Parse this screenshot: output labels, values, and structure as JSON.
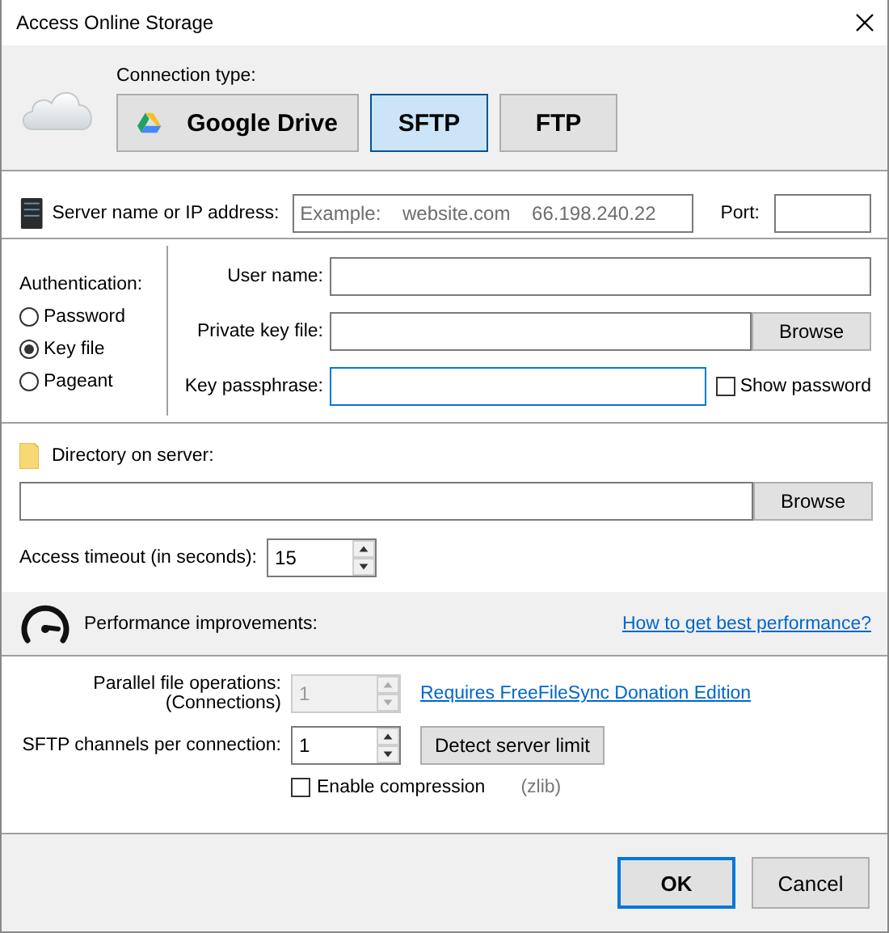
{
  "window": {
    "title": "Access Online Storage"
  },
  "connection": {
    "label": "Connection type:",
    "types": [
      {
        "label": "Google Drive",
        "kind": "google-drive",
        "selected": false
      },
      {
        "label": "SFTP",
        "kind": "plain",
        "selected": true
      },
      {
        "label": "FTP",
        "kind": "plain",
        "selected": false
      }
    ]
  },
  "server": {
    "label": "Server name or IP address:",
    "placeholder": "Example:    website.com    66.198.240.22",
    "port_label": "Port:"
  },
  "authentication": {
    "label": "Authentication:",
    "options": [
      {
        "label": "Password",
        "selected": false
      },
      {
        "label": "Key file",
        "selected": true
      },
      {
        "label": "Pageant",
        "selected": false
      }
    ]
  },
  "fields": [
    {
      "label": "User name:",
      "kind": "text",
      "focused": false
    },
    {
      "label": "Private key file:",
      "kind": "browse",
      "focused": false,
      "button": "Browse"
    },
    {
      "label": "Key passphrase:",
      "kind": "password",
      "focused": true,
      "show_password": {
        "label": "Show password",
        "checked": false
      }
    }
  ],
  "directory": {
    "label": "Directory on server:",
    "button": "Browse"
  },
  "timeout": {
    "label": "Access timeout (in seconds):",
    "value": "15"
  },
  "performance": {
    "label": "Performance improvements:",
    "link": "How to get best performance?",
    "parallel": {
      "label": "Parallel file operations:\n(Connections)",
      "value": "1",
      "disabled": true,
      "link": "Requires FreeFileSync Donation Edition"
    },
    "channels": {
      "label": "SFTP channels per connection:",
      "value": "1",
      "disabled": false,
      "button": "Detect server limit"
    },
    "compression": {
      "label": "Enable compression",
      "checked": false,
      "note": "(zlib)"
    }
  },
  "buttons": [
    {
      "label": "OK",
      "default": true
    },
    {
      "label": "Cancel",
      "default": false
    }
  ]
}
